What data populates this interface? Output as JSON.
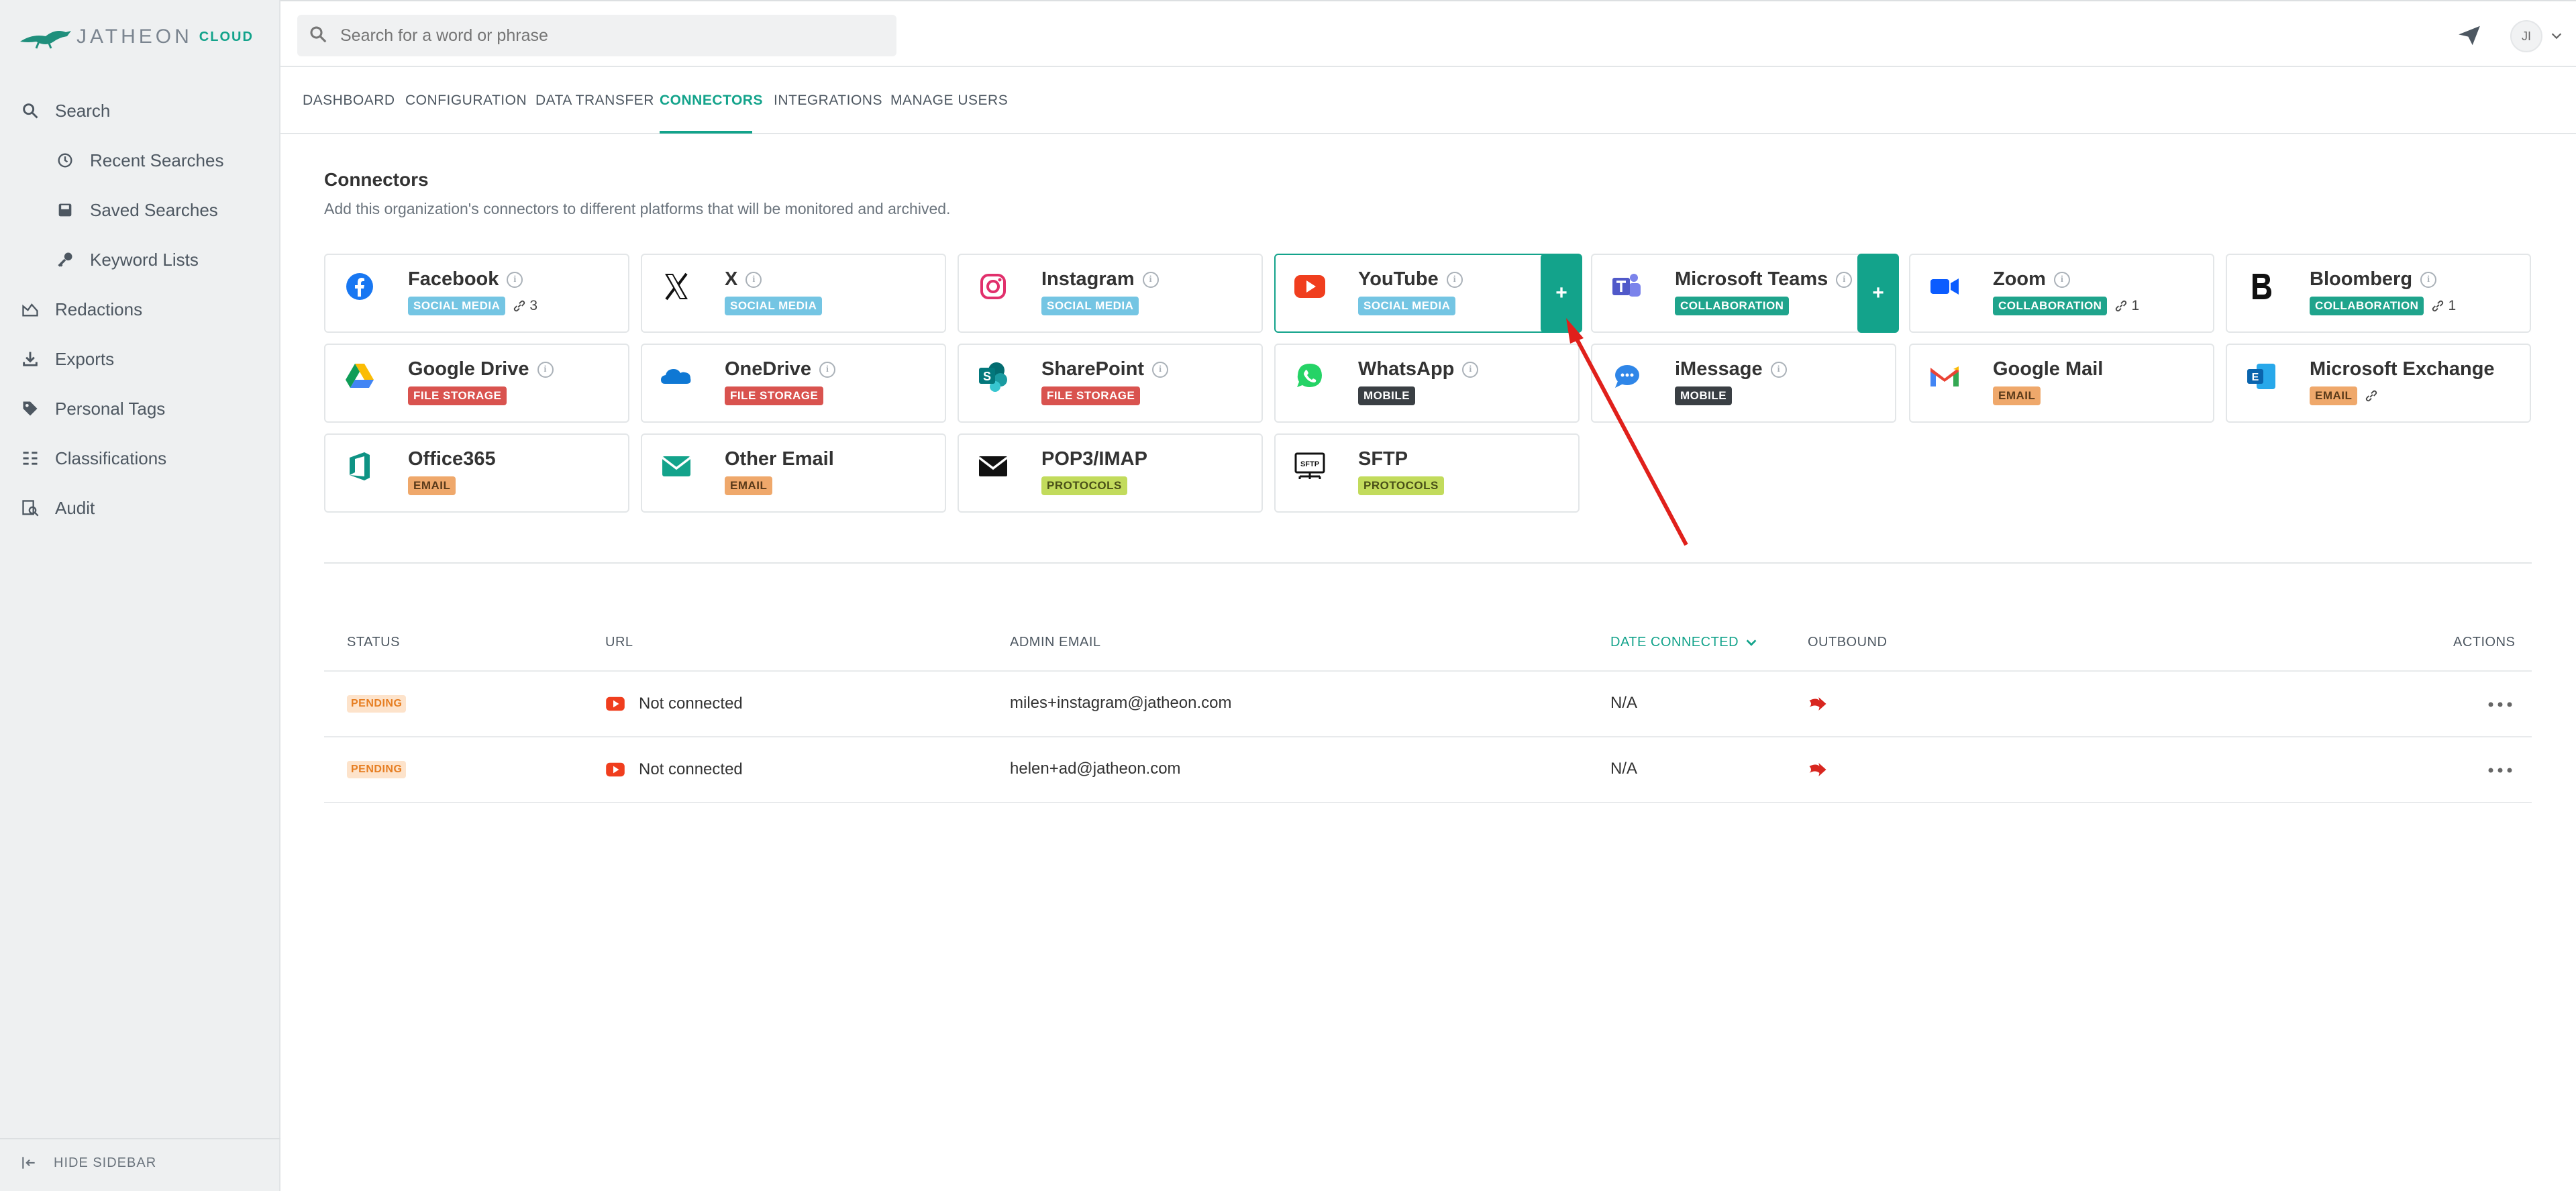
{
  "brand": {
    "name": "JATHEON",
    "suffix": "CLOUD"
  },
  "search": {
    "placeholder": "Search for a word or phrase"
  },
  "user": {
    "initials": "JI"
  },
  "sidebar": {
    "items": [
      {
        "label": "Search",
        "icon": "search-icon"
      },
      {
        "label": "Recent Searches",
        "icon": "history-icon"
      },
      {
        "label": "Saved Searches",
        "icon": "save-icon"
      },
      {
        "label": "Keyword Lists",
        "icon": "key-icon"
      },
      {
        "label": "Redactions",
        "icon": "redaction-icon"
      },
      {
        "label": "Exports",
        "icon": "download-icon"
      },
      {
        "label": "Personal Tags",
        "icon": "tag-icon"
      },
      {
        "label": "Classifications",
        "icon": "classification-icon"
      },
      {
        "label": "Audit",
        "icon": "audit-icon"
      }
    ],
    "hide_label": "HIDE SIDEBAR"
  },
  "tabs": [
    "DASHBOARD",
    "CONFIGURATION",
    "DATA TRANSFER",
    "CONNECTORS",
    "INTEGRATIONS",
    "MANAGE USERS"
  ],
  "active_tab": "CONNECTORS",
  "connectors_section": {
    "title": "Connectors",
    "description": "Add this organization's connectors to different platforms that will be monitored and archived."
  },
  "connectors": [
    {
      "name": "Facebook",
      "category": "SOCIAL MEDIA",
      "links": "3",
      "icon": "facebook-icon"
    },
    {
      "name": "X",
      "category": "SOCIAL MEDIA",
      "icon": "x-icon"
    },
    {
      "name": "Instagram",
      "category": "SOCIAL MEDIA",
      "icon": "instagram-icon"
    },
    {
      "name": "YouTube",
      "category": "SOCIAL MEDIA",
      "icon": "youtube-icon"
    },
    {
      "name": "Microsoft Teams",
      "category": "COLLABORATION",
      "icon": "teams-icon"
    },
    {
      "name": "Zoom",
      "category": "COLLABORATION",
      "links": "1",
      "icon": "zoom-icon"
    },
    {
      "name": "Bloomberg",
      "category": "COLLABORATION",
      "links": "1",
      "icon": "bloomberg-icon"
    },
    {
      "name": "Google Drive",
      "category": "FILE STORAGE",
      "icon": "google-drive-icon"
    },
    {
      "name": "OneDrive",
      "category": "FILE STORAGE",
      "icon": "onedrive-icon"
    },
    {
      "name": "SharePoint",
      "category": "FILE STORAGE",
      "icon": "sharepoint-icon"
    },
    {
      "name": "WhatsApp",
      "category": "MOBILE",
      "icon": "whatsapp-icon"
    },
    {
      "name": "iMessage",
      "category": "MOBILE",
      "icon": "imessage-icon"
    },
    {
      "name": "Google Mail",
      "category": "EMAIL",
      "icon": "gmail-icon"
    },
    {
      "name": "Microsoft Exchange",
      "category": "EMAIL",
      "icon": "exchange-icon"
    },
    {
      "name": "Office365",
      "category": "EMAIL",
      "icon": "office365-icon"
    },
    {
      "name": "Other Email",
      "category": "EMAIL",
      "icon": "email-icon"
    },
    {
      "name": "POP3/IMAP",
      "category": "PROTOCOLS",
      "icon": "envelope-icon"
    },
    {
      "name": "SFTP",
      "category": "PROTOCOLS",
      "icon": "sftp-icon"
    }
  ],
  "plus_label": "+",
  "table": {
    "headers": [
      "STATUS",
      "URL",
      "ADMIN EMAIL",
      "DATE CONNECTED",
      "OUTBOUND",
      "ACTIONS"
    ],
    "rows": [
      {
        "status": "PENDING",
        "url": "Not connected",
        "admin_email": "miles+instagram@jatheon.com",
        "date": "N/A"
      },
      {
        "status": "PENDING",
        "url": "Not connected",
        "admin_email": "helen+ad@jatheon.com",
        "date": "N/A"
      }
    ]
  },
  "colors": {
    "accent": "#13a38b",
    "arrow": "#e0201b"
  }
}
